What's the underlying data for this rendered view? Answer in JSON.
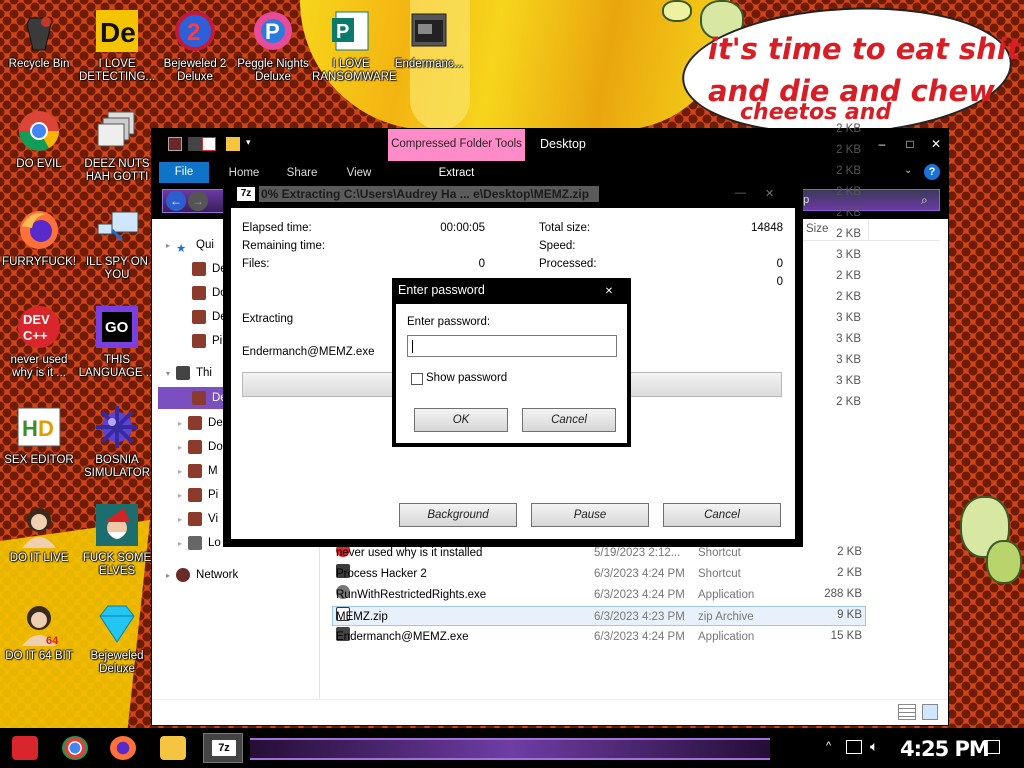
{
  "wallpaper": {
    "speech_lines": [
      "it's time to eat shit",
      "and die and chew",
      "cheetos and"
    ]
  },
  "desktop_icons": [
    {
      "label": "Recycle Bin",
      "icon": "recycle-bin-icon"
    },
    {
      "label": "I LOVE DETECTING...",
      "icon": "detect-it-easy-icon"
    },
    {
      "label": "Bejeweled 2 Deluxe",
      "icon": "bejeweled-2-icon"
    },
    {
      "label": "Peggle Nights Deluxe",
      "icon": "peggle-icon"
    },
    {
      "label": "I LOVE RANSOMWARE",
      "icon": "publisher-icon"
    },
    {
      "label": "Endermanc...",
      "icon": "app-window-icon"
    },
    {
      "label": "DO EVIL",
      "icon": "chrome-icon"
    },
    {
      "label": "DEEZ NUTS HAH GOTTI",
      "icon": "stacked-windows-icon"
    },
    {
      "label": "FURRYFUCK!",
      "icon": "firefox-icon"
    },
    {
      "label": "ILL SPY ON YOU",
      "icon": "remote-desktop-icon"
    },
    {
      "label": "never used why is it ...",
      "icon": "dev-cpp-icon"
    },
    {
      "label": "THIS LANGUAGE ...",
      "icon": "goland-icon"
    },
    {
      "label": "SEX EDITOR",
      "icon": "hxd-icon"
    },
    {
      "label": "BOSNIA SIMULATOR",
      "icon": "mine-icon"
    },
    {
      "label": "DO IT LIVE",
      "icon": "portrait-icon"
    },
    {
      "label": "FUCK SOME ELVES",
      "icon": "santa-icon"
    },
    {
      "label": "DO IT 64 BIT",
      "icon": "portrait-64-icon"
    },
    {
      "label": "Bejeweled Deluxe",
      "icon": "diamond-icon"
    }
  ],
  "explorer": {
    "contextual_tab": "Compressed Folder Tools",
    "window_title": "Desktop",
    "ribbon_tabs": [
      "File",
      "Home",
      "Share",
      "View",
      "Extract"
    ],
    "search_placeholder": "op",
    "size_header": "Size",
    "nav": [
      {
        "label": "Qui"
      },
      {
        "label": "De"
      },
      {
        "label": "Do"
      },
      {
        "label": "De"
      },
      {
        "label": "Pi"
      },
      {
        "label": "Thi"
      },
      {
        "label": "De"
      },
      {
        "label": "De"
      },
      {
        "label": "Do"
      },
      {
        "label": "M"
      },
      {
        "label": "Pi"
      },
      {
        "label": "Vi"
      },
      {
        "label": "Lo"
      },
      {
        "label": "Network"
      }
    ],
    "sizes_top": [
      "2 KB",
      "2 KB",
      "2 KB",
      "2 KB",
      "2 KB",
      "2 KB",
      "3 KB",
      "2 KB",
      "2 KB",
      "3 KB",
      "3 KB",
      "3 KB",
      "3 KB",
      "2 KB"
    ],
    "files": [
      {
        "name": "never used why is it installed",
        "date": "5/19/2023 2:12...",
        "type": "Shortcut",
        "size": "2 KB"
      },
      {
        "name": "Process Hacker 2",
        "date": "6/3/2023 4:24 PM",
        "type": "Shortcut",
        "size": "2 KB"
      },
      {
        "name": "RunWithRestrictedRights.exe",
        "date": "6/3/2023 4:24 PM",
        "type": "Application",
        "size": "288 KB"
      },
      {
        "name": "MEMZ.zip",
        "date": "6/3/2023 4:23 PM",
        "type": "zip Archive",
        "size": "9 KB"
      },
      {
        "name": "Endermanch@MEMZ.exe",
        "date": "6/3/2023 4:24 PM",
        "type": "Application",
        "size": "15 KB"
      }
    ]
  },
  "zip_progress": {
    "badge": "7z",
    "title": "0% Extracting C:\\Users\\Audrey Ha ... e\\Desktop\\MEMZ.zip",
    "elapsed_label": "Elapsed time:",
    "elapsed_value": "00:00:05",
    "remaining_label": "Remaining time:",
    "files_label": "Files:",
    "files_value": "0",
    "total_size_label": "Total size:",
    "total_size_value": "14848",
    "speed_label": "Speed:",
    "processed_label": "Processed:",
    "processed_value": "0",
    "extra_value": "0",
    "extracting_label": "Extracting",
    "current_file": "Endermanch@MEMZ.exe",
    "progress": 0,
    "btn_background": "Background",
    "btn_pause": "Pause",
    "btn_cancel": "Cancel"
  },
  "password_dialog": {
    "title": "Enter password",
    "close": "✕",
    "prompt": "Enter password:",
    "value": "",
    "show_password": "Show password",
    "show_password_checked": false,
    "ok": "OK",
    "cancel": "Cancel"
  },
  "taskbar": {
    "clock": "4:25 PM",
    "tray_icons": [
      "chevron-up-icon",
      "network-icon",
      "volume-icon"
    ],
    "pinned": [
      "start-button-icon",
      "chrome-icon",
      "firefox-icon",
      "file-explorer-icon",
      "7zip-icon"
    ]
  }
}
